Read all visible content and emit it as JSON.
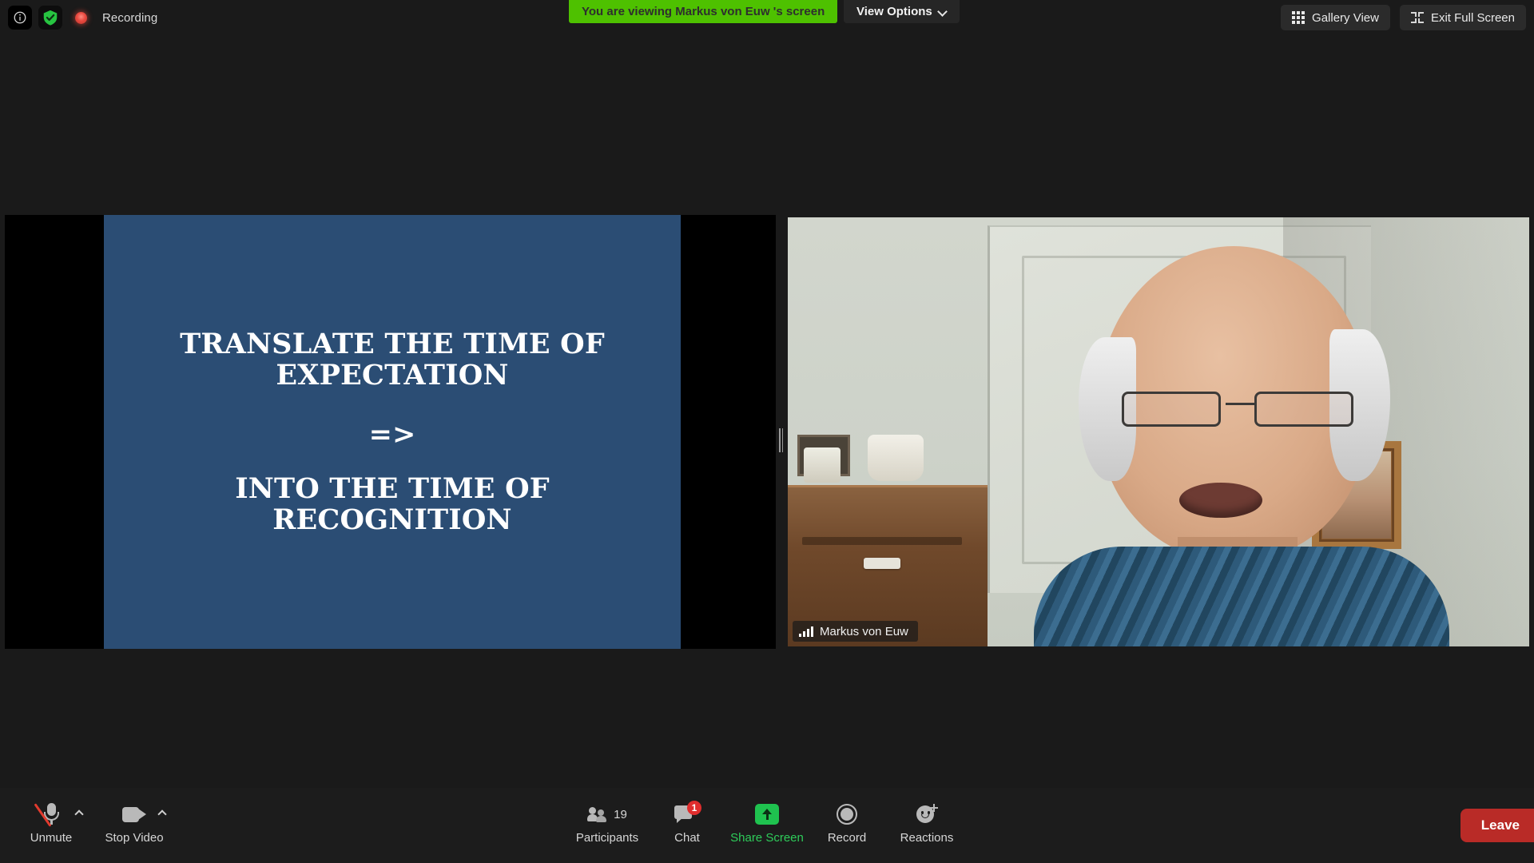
{
  "app": {
    "name": "Zoom Meeting"
  },
  "topbar": {
    "info_icon": "info-icon",
    "shield_icon": "shield-check-icon",
    "recording_indicator_icon": "recording-dot-icon",
    "recording_label": "Recording",
    "viewing_banner": "You are viewing Markus von Euw 's screen",
    "view_options_label": "View Options",
    "view_options_icon": "chevron-down-icon",
    "gallery_view_label": "Gallery View",
    "gallery_view_icon": "grid-icon",
    "exit_full_screen_label": "Exit Full Screen",
    "exit_full_screen_icon": "exit-fullscreen-icon"
  },
  "shared_screen": {
    "presenter": "Markus von Euw",
    "slide": {
      "background_color": "#2b4d74",
      "text_color": "#ffffff",
      "line1": "TRANSLATE THE TIME OF",
      "line2": "EXPECTATION",
      "arrow": "=>",
      "line3": "INTO THE TIME OF",
      "line4": "RECOGNITION"
    }
  },
  "video_tile": {
    "name": "Markus von Euw",
    "signal_icon": "signal-bars-icon"
  },
  "toolbar": {
    "audio": {
      "label": "Unmute",
      "icon": "microphone-muted-icon",
      "caret_icon": "chevron-up-icon"
    },
    "video": {
      "label": "Stop Video",
      "icon": "camera-icon",
      "caret_icon": "chevron-up-icon"
    },
    "participants": {
      "label": "Participants",
      "icon": "people-icon",
      "count": "19"
    },
    "chat": {
      "label": "Chat",
      "icon": "chat-bubble-icon",
      "badge": "1"
    },
    "share": {
      "label": "Share Screen",
      "icon": "share-arrow-icon",
      "color": "#2ecc5a"
    },
    "record": {
      "label": "Record",
      "icon": "record-circle-icon"
    },
    "reactions": {
      "label": "Reactions",
      "icon": "smiley-plus-icon"
    },
    "leave": {
      "label": "Leave",
      "color": "#b92b27"
    }
  }
}
